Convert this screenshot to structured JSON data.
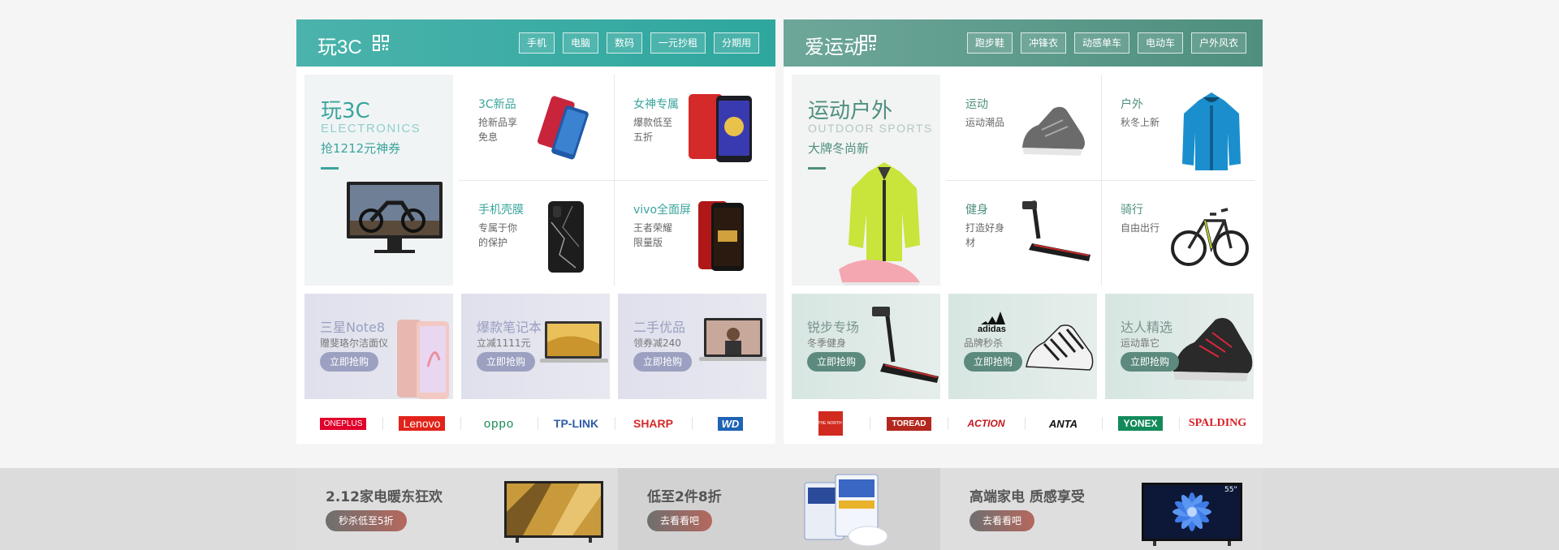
{
  "left_panel": {
    "title": "玩3C",
    "tags": [
      "手机",
      "电脑",
      "数码",
      "一元抄租",
      "分期用"
    ],
    "feature": {
      "title": "玩3C",
      "subtitle_en": "ELECTRONICS",
      "subtitle": "抢1212元神券"
    },
    "cells": [
      {
        "title": "3C新品",
        "desc": "抢新品享免息"
      },
      {
        "title": "女神专属",
        "desc": "爆款低至五折"
      },
      {
        "title": "手机壳膜",
        "desc": "专属于你的保护"
      },
      {
        "title": "vivo全面屏",
        "desc": "王者荣耀限量版"
      }
    ],
    "promos": [
      {
        "title": "三星Note8",
        "subtitle": "赠斐珞尔洁面仪",
        "button": "立即抢购"
      },
      {
        "title": "爆款笔记本",
        "subtitle": "立减1111元",
        "button": "立即抢购"
      },
      {
        "title": "二手优品",
        "subtitle": "领券减240",
        "button": "立即抢购"
      }
    ],
    "brands": [
      "ONEPLUS",
      "Lenovo",
      "oppo",
      "TP-LINK",
      "SHARP",
      "WD"
    ]
  },
  "right_panel": {
    "title": "爱运动",
    "tags": [
      "跑步鞋",
      "冲锋衣",
      "动感单车",
      "电动车",
      "户外风衣"
    ],
    "feature": {
      "title": "运动户外",
      "subtitle_en": "OUTDOOR SPORTS",
      "subtitle": "大牌冬尚新"
    },
    "cells": [
      {
        "title": "运动",
        "desc": "运动潮品"
      },
      {
        "title": "户外",
        "desc": "秋冬上新"
      },
      {
        "title": "健身",
        "desc": "打造好身材"
      },
      {
        "title": "骑行",
        "desc": "自由出行"
      }
    ],
    "promos": [
      {
        "title": "锐步专场",
        "subtitle": "冬季健身",
        "button": "立即抢购"
      },
      {
        "title": "",
        "subtitle": "品牌秒杀",
        "button": "立即抢购"
      },
      {
        "title": "达人精选",
        "subtitle": "运动靠它",
        "button": "立即抢购"
      }
    ],
    "brands": [
      "THE NORTH FACE",
      "TOREAD",
      "ACTION",
      "ANTA",
      "YONEX",
      "SPALDING"
    ],
    "adidas_logo": "adidas"
  },
  "bottom_banners": [
    {
      "title": "2.12家电暖东狂欢",
      "button": "秒杀低至5折"
    },
    {
      "title": "低至2件8折",
      "button": "去看看吧"
    },
    {
      "title": "高端家电 质感享受",
      "button": "去看看吧"
    }
  ],
  "tv_badge": "55\"",
  "colors": {
    "teal": "#2ea79e",
    "green": "#4e8f7e"
  }
}
